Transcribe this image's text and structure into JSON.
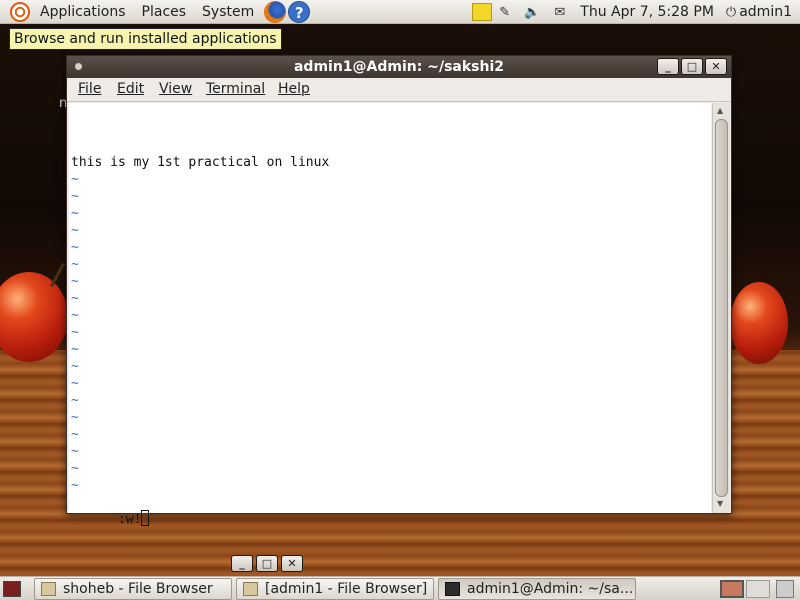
{
  "top_panel": {
    "menus": [
      "Applications",
      "Places",
      "System"
    ],
    "clock": "Thu Apr  7,  5:28 PM",
    "user": "admin1"
  },
  "tooltip": "Browse and run installed applications",
  "desktop_stray_text": "n",
  "terminal": {
    "title": "admin1@Admin: ~/sakshi2",
    "menus": [
      "File",
      "Edit",
      "View",
      "Terminal",
      "Help"
    ],
    "content_line": "this is my 1st practical on linux",
    "tilde": "~",
    "command": ":w!"
  },
  "taskbar": {
    "items": [
      {
        "label": "shoheb - File Browser",
        "icon": "folder-icon"
      },
      {
        "label": "[admin1 - File Browser]",
        "icon": "folder-icon"
      },
      {
        "label": "admin1@Admin: ~/sa...",
        "icon": "terminal-icon"
      }
    ]
  }
}
